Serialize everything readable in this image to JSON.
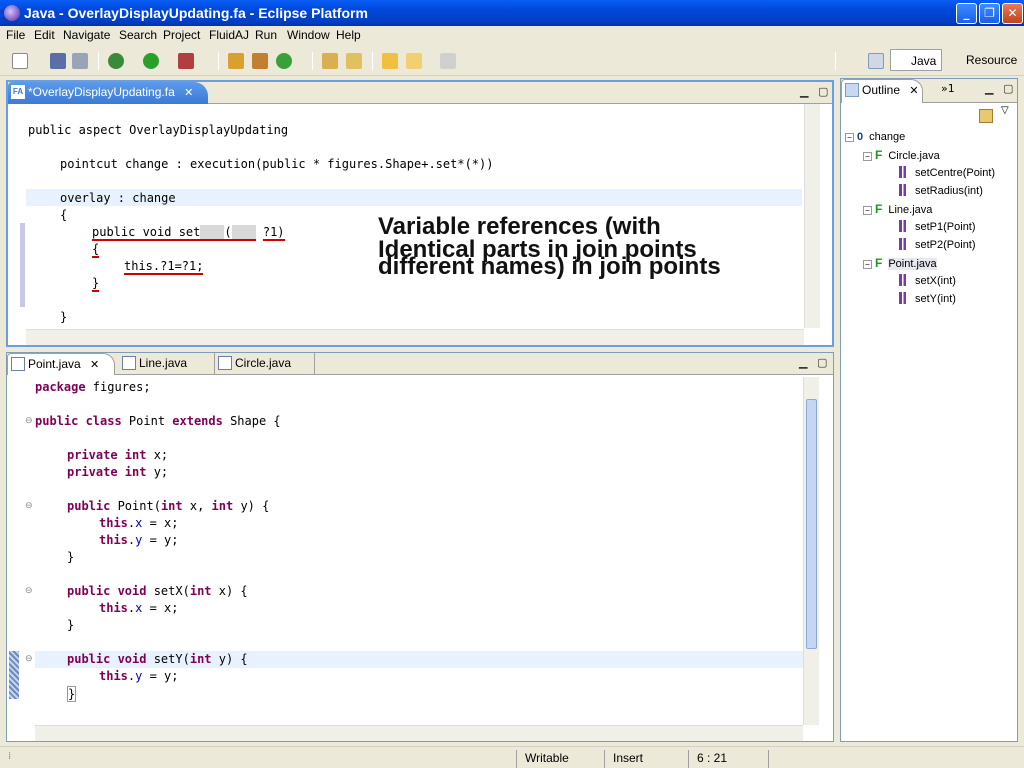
{
  "window": {
    "title": "Java - OverlayDisplayUpdating.fa - Eclipse Platform"
  },
  "menu": [
    "File",
    "Edit",
    "Navigate",
    "Search",
    "Project",
    "FluidAJ",
    "Run",
    "Window",
    "Help"
  ],
  "perspectives": {
    "java": "Java",
    "resource": "Resource"
  },
  "editor_top": {
    "tab_label": "*OverlayDisplayUpdating.fa",
    "tab_icon": "fa-file-icon",
    "lines": {
      "l1_kw": "public aspect OverlayDisplayUpdating",
      "l2": "pointcut change : execution(public * figures.Shape+.set*(*))",
      "l3": "overlay : change",
      "l4": "{",
      "l5_a": "public void set",
      "l5_b": "(",
      "l5_c": "?1)",
      "l6": "{",
      "l7": "this.?1=?1;",
      "l8": "}",
      "l9": "}"
    },
    "callout": {
      "line1": "Variable references (with",
      "line2": "Identical parts in join points",
      "line3": "different names) in join points"
    }
  },
  "editor_bottom": {
    "tabs": [
      {
        "label": "Point.java",
        "icon": "java-file-icon"
      },
      {
        "label": "Line.java",
        "icon": "java-file-icon"
      },
      {
        "label": "Circle.java",
        "icon": "java-file-icon"
      }
    ],
    "code": {
      "package_kw": "package",
      "package_rest": " figures;",
      "class_kw1": "public class",
      "class_name": " Point ",
      "class_kw2": "extends",
      "class_rest": " Shape {",
      "f1_kw": "private int",
      "f1_rest": " x;",
      "f2_kw": "private int",
      "f2_rest": " y;",
      "ctor_kw": "public",
      "ctor_a": " Point(",
      "ctor_int1": "int",
      "ctor_b": " x, ",
      "ctor_int2": "int",
      "ctor_c": " y) {",
      "c1_this": "this",
      "c1_dot": ".",
      "c1_fld": "x",
      "c1_rest": " = x;",
      "c2_this": "this",
      "c2_dot": ".",
      "c2_fld": "y",
      "c2_rest": " = y;",
      "close1": "}",
      "sx_kw": "public void",
      "sx_a": " setX(",
      "sx_int": "int",
      "sx_b": " x) {",
      "sx_this": "this",
      "sx_fld": "x",
      "sx_rest": " = x;",
      "close2": "}",
      "sy_kw": "public void",
      "sy_a": " setY(",
      "sy_int": "int",
      "sy_b": " y) {",
      "sy_this": "this",
      "sy_fld": "y",
      "sy_rest": " = y;",
      "close3": "}"
    }
  },
  "outline": {
    "tab_label": "Outline",
    "overflow_label": "»1",
    "items": [
      {
        "label": "change",
        "kind": "pointcut"
      },
      {
        "label": "Circle.java",
        "kind": "file"
      },
      {
        "label": "setCentre(Point)",
        "kind": "method"
      },
      {
        "label": "setRadius(int)",
        "kind": "method"
      },
      {
        "label": "Line.java",
        "kind": "file"
      },
      {
        "label": "setP1(Point)",
        "kind": "method"
      },
      {
        "label": "setP2(Point)",
        "kind": "method"
      },
      {
        "label": "Point.java",
        "kind": "file"
      },
      {
        "label": "setX(int)",
        "kind": "method"
      },
      {
        "label": "setY(int)",
        "kind": "method"
      }
    ]
  },
  "status": {
    "writable": "Writable",
    "mode": "Insert",
    "position": "6 : 21"
  },
  "colors": {
    "keyword": "#7f0055",
    "field": "#0000c0",
    "titlebar": "#0047d9",
    "error_underline": "#d00000"
  }
}
